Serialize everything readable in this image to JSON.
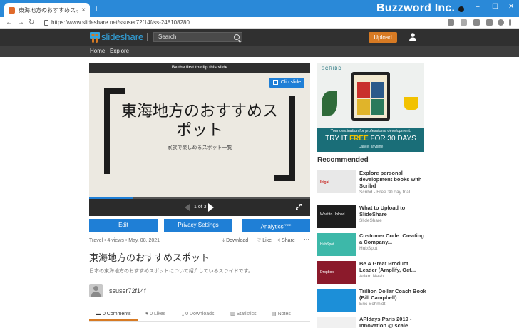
{
  "browser": {
    "tab_title": "東海地方のおすすめスポット",
    "tab_close": "×",
    "new_tab": "+",
    "brand": "Buzzword Inc.",
    "url": "https://www.slideshare.net/ssuser72f14f/ss-248108280",
    "nav_back": "←",
    "nav_forward": "→",
    "nav_reload": "↻",
    "win_min": "–",
    "win_max": "☐",
    "win_close": "✕"
  },
  "header": {
    "logo_text": "slideshare",
    "search_placeholder": "Search",
    "upload_label": "Upload",
    "subnav": [
      "Home",
      "Explore"
    ]
  },
  "player": {
    "clip_bar_text": "Be the first to clip this slide",
    "clip_button": "Clip slide",
    "slide_title": "東海地方のおすすめスポット",
    "slide_subtitle": "家族で楽しめるスポット一覧",
    "page_indicator": "1 of 3",
    "progress": 0.2
  },
  "actions": {
    "edit": "Edit",
    "privacy": "Privacy Settings",
    "analytics": "Analytics",
    "analytics_badge": "FREE"
  },
  "meta": {
    "info": "Travel • 4 views • May. 08, 2021",
    "download": "Download",
    "like": "Like",
    "share": "Share",
    "more": "···"
  },
  "content": {
    "title": "東海地方のおすすめスポット",
    "description": "日本の東海地方のおすすめスポットについて紹介しているスライドです。",
    "username": "ssuser72f14f"
  },
  "tabs": [
    "0 Comments",
    "0 Likes",
    "0 Downloads",
    "Statistics",
    "Notes"
  ],
  "ad": {
    "brand": "SCRIBD",
    "line1": "Your destination for professional development.",
    "line2_a": "TRY IT ",
    "line2_b": "FREE",
    "line2_c": " FOR 30 DAYS",
    "line3": "Cancel anytime"
  },
  "recommended": {
    "heading": "Recommended",
    "items": [
      {
        "title": "Explore personal development books with Scribd",
        "source": "Scribd - Free 30 day trial",
        "thumb_color": "#e8e8e8",
        "thumb_label": "Ikigai"
      },
      {
        "title": "What to Upload to SlideShare",
        "source": "SlideShare",
        "thumb_color": "#1e1e1e",
        "thumb_label": "What to Upload"
      },
      {
        "title": "Customer Code: Creating a Company...",
        "source": "HubSpot",
        "thumb_color": "#3db8a9",
        "thumb_label": "HubSpot"
      },
      {
        "title": "Be A Great Product Leader (Amplify, Oct...",
        "source": "Adam Nash",
        "thumb_color": "#8b1a2b",
        "thumb_label": "Dropbox"
      },
      {
        "title": "Trillion Dollar Coach Book (Bill Campbell)",
        "source": "Eric Schmidt",
        "thumb_color": "#1c8fd8",
        "thumb_label": ""
      },
      {
        "title": "APIdays Paris 2019 - Innovation @ scale",
        "source": "",
        "thumb_color": "#f0f0f0",
        "thumb_label": ""
      }
    ]
  }
}
